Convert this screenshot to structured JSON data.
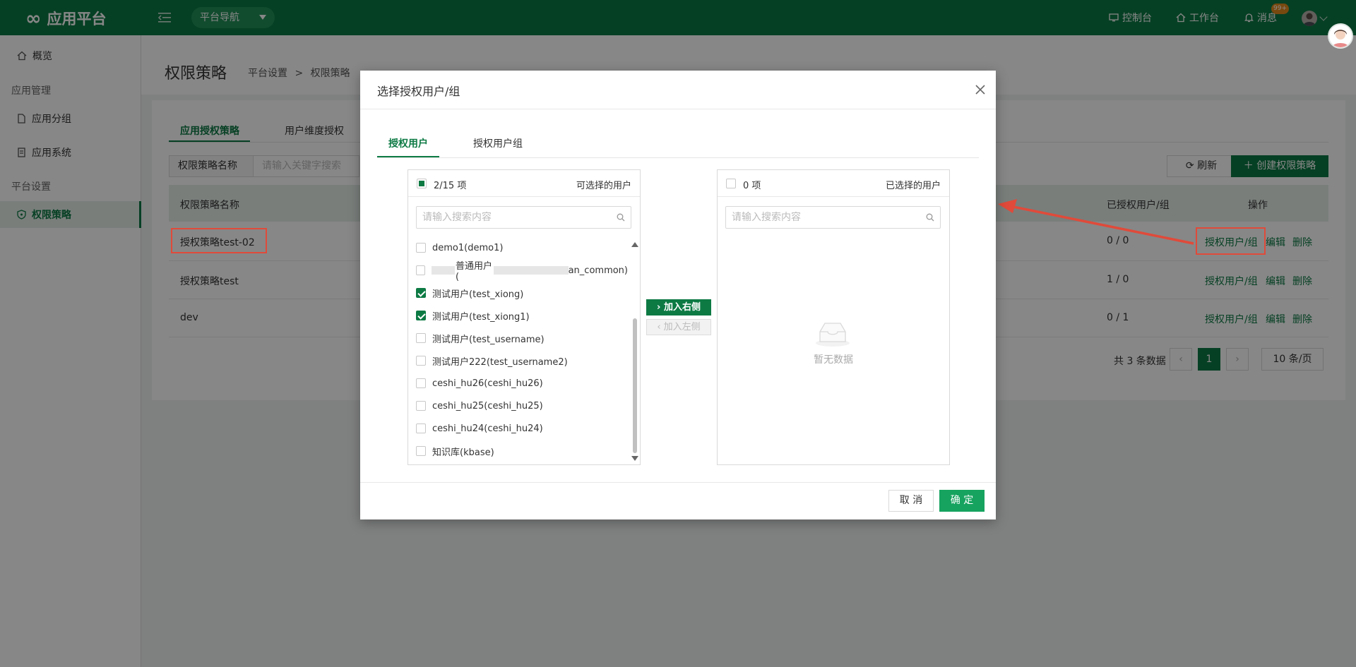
{
  "topbar": {
    "brand": "应用平台",
    "platform_nav": "平台导航",
    "console": "控制台",
    "workbench": "工作台",
    "messages": "消息",
    "message_badge": "99+"
  },
  "sidebar": {
    "overview": "概览",
    "group_app_mgmt": "应用管理",
    "app_group": "应用分组",
    "app_system": "应用系统",
    "group_platform": "平台设置",
    "permission_policy": "权限策略"
  },
  "page": {
    "title": "权限策略",
    "breadcrumb": [
      "平台设置",
      ">",
      "权限策略"
    ],
    "tabs": [
      "应用授权策略",
      "用户维度授权"
    ],
    "filter_field": "权限策略名称",
    "filter_placeholder": "请输入关键字搜索",
    "refresh": "刷新",
    "create": "创建权限策略",
    "columns": {
      "name": "权限策略名称",
      "authorized": "已授权用户/组",
      "actions": "操作"
    },
    "rows": [
      {
        "name": "授权策略test-02",
        "authorized": "0 / 0"
      },
      {
        "name": "授权策略test",
        "authorized": "1 / 0"
      },
      {
        "name": "dev",
        "authorized": "0 / 1"
      }
    ],
    "action_labels": {
      "authorize": "授权用户/组",
      "edit": "编辑",
      "delete": "删除"
    },
    "pagination": {
      "total": "共 3 条数据",
      "current": "1",
      "page_size": "10 条/页"
    }
  },
  "modal": {
    "title": "选择授权用户/组",
    "tabs": [
      "授权用户",
      "授权用户组"
    ],
    "left_panel": {
      "count": "2/15 项",
      "title": "可选择的用户",
      "search_placeholder": "请输入搜索内容",
      "items": [
        {
          "label": "demo1(demo1)",
          "checked": false
        },
        {
          "label": "普通用户(",
          "label_tail": "an_common)",
          "checked": false
        },
        {
          "label": "测试用户(test_xiong)",
          "checked": true
        },
        {
          "label": "测试用户(test_xiong1)",
          "checked": true
        },
        {
          "label": "测试用户(test_username)",
          "checked": false
        },
        {
          "label": "测试用户222(test_username2)",
          "checked": false
        },
        {
          "label": "ceshi_hu26(ceshi_hu26)",
          "checked": false
        },
        {
          "label": "ceshi_hu25(ceshi_hu25)",
          "checked": false
        },
        {
          "label": "ceshi_hu24(ceshi_hu24)",
          "checked": false
        },
        {
          "label": "知识库(kbase)",
          "checked": false
        }
      ]
    },
    "transfer": {
      "add_right": "加入右侧",
      "add_left": "加入左侧"
    },
    "right_panel": {
      "count": "0 项",
      "title": "已选择的用户",
      "search_placeholder": "请输入搜索内容",
      "empty": "暂无数据"
    },
    "cancel": "取 消",
    "confirm": "确 定"
  },
  "colors": {
    "brand": "#0d7a44",
    "annotation": "#e04a3a"
  }
}
